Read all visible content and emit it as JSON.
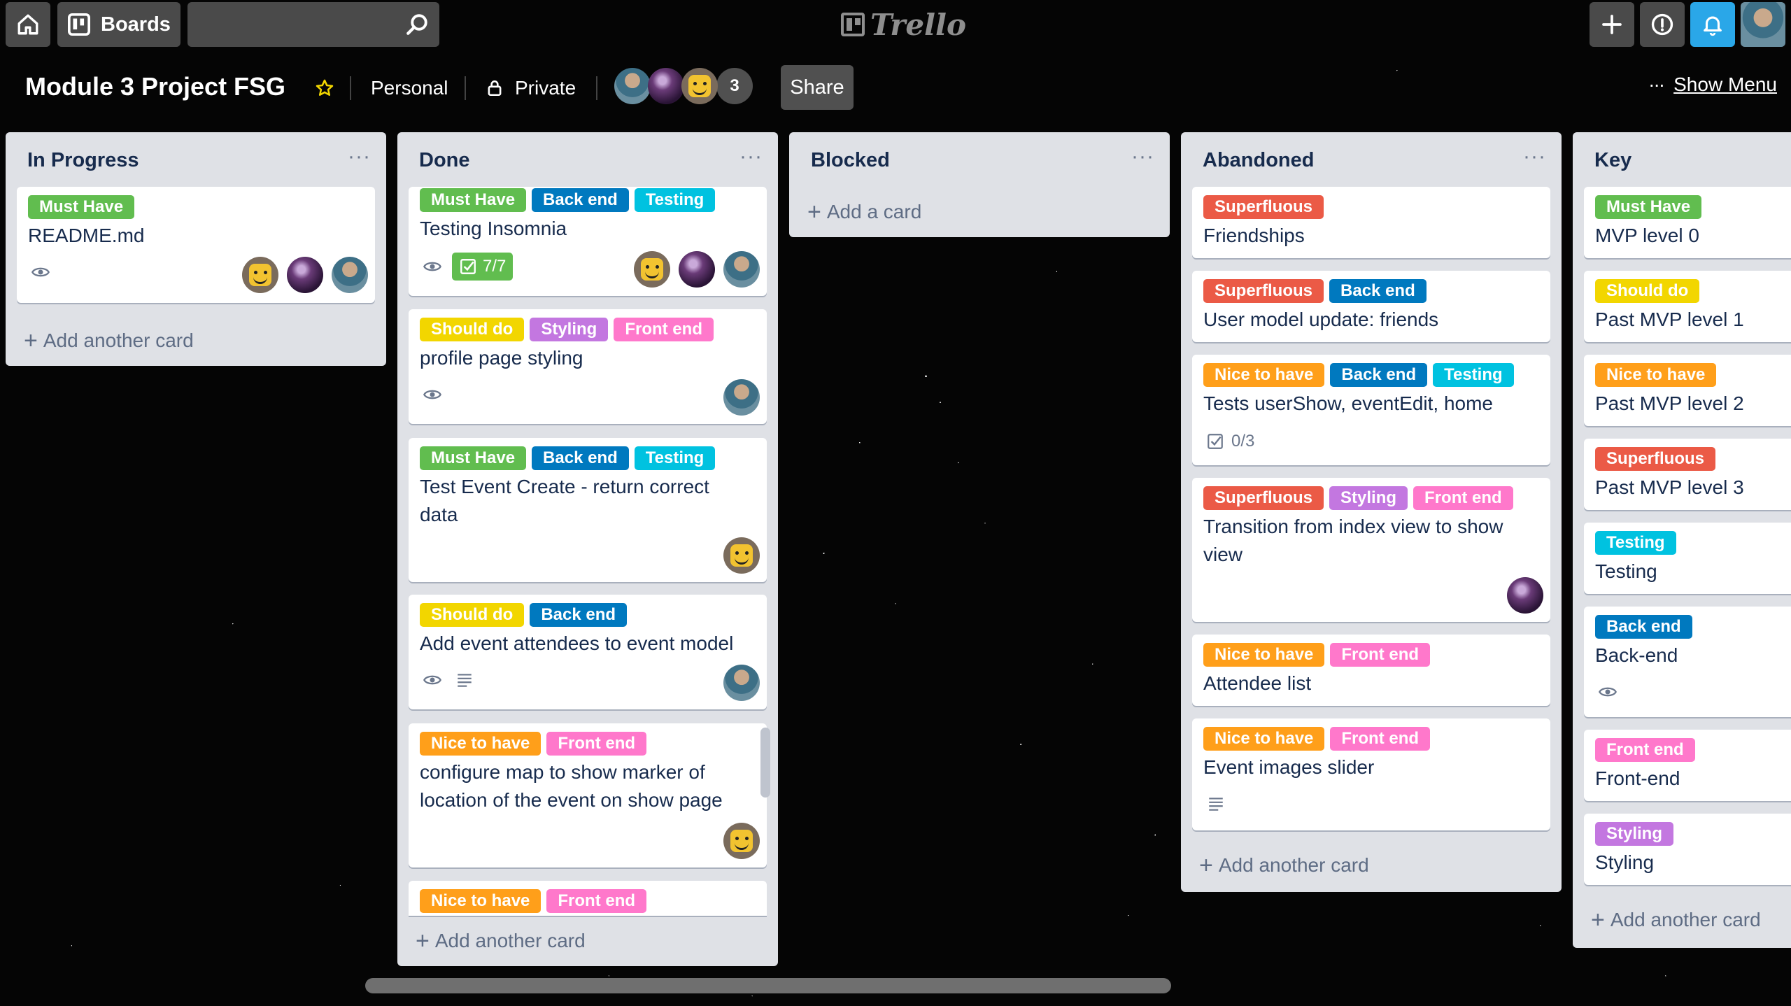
{
  "header": {
    "boards_label": "Boards",
    "search_placeholder": "",
    "logo_text": "Trello"
  },
  "board": {
    "title": "Module 3 Project FSG",
    "team": "Personal",
    "visibility": "Private",
    "member_count": "3",
    "share_label": "Share",
    "show_menu_label": "Show Menu"
  },
  "colors": {
    "green": "#61bd4f",
    "yellow": "#f2d600",
    "orange": "#ff9f1a",
    "red": "#eb5a46",
    "purple": "#c377e0",
    "blue": "#0079bf",
    "sky": "#00c2e0",
    "pink": "#ff78cb"
  },
  "lists": {
    "in_progress": {
      "title": "In Progress",
      "add_label": "Add another card",
      "cards": [
        {
          "labels": [
            "Must Have"
          ],
          "title": "README.md"
        }
      ]
    },
    "done": {
      "title": "Done",
      "add_label": "Add another card",
      "cards": [
        {
          "labels": [
            "Must Have",
            "Back end",
            "Testing"
          ],
          "title": "Testing Insomnia",
          "checklist": "7/7"
        },
        {
          "labels": [
            "Should do",
            "Styling",
            "Front end"
          ],
          "title": "profile page styling"
        },
        {
          "labels": [
            "Must Have",
            "Back end",
            "Testing"
          ],
          "title_line1": "Test Event Create - return correct",
          "title_line2": "data"
        },
        {
          "labels": [
            "Should do",
            "Back end"
          ],
          "title": "Add event attendees to event model"
        },
        {
          "labels": [
            "Nice to have",
            "Front end"
          ],
          "title_line1": "configure map to show marker of",
          "title_line2": "location of the event on show page"
        },
        {
          "labels": [
            "Nice to have",
            "Front end"
          ]
        }
      ]
    },
    "blocked": {
      "title": "Blocked",
      "add_label": "Add a card"
    },
    "abandoned": {
      "title": "Abandoned",
      "add_label": "Add another card",
      "cards": [
        {
          "labels": [
            "Superfluous"
          ],
          "title": "Friendships"
        },
        {
          "labels": [
            "Superfluous",
            "Back end"
          ],
          "title": "User model update: friends"
        },
        {
          "labels": [
            "Nice to have",
            "Back end",
            "Testing"
          ],
          "title": "Tests userShow, eventEdit, home",
          "checklist": "0/3"
        },
        {
          "labels": [
            "Superfluous",
            "Styling",
            "Front end"
          ],
          "title_line1": "Transition from index view to show",
          "title_line2": "view"
        },
        {
          "labels": [
            "Nice to have",
            "Front end"
          ],
          "title": "Attendee list"
        },
        {
          "labels": [
            "Nice to have",
            "Front end"
          ],
          "title": "Event images slider"
        }
      ]
    },
    "key": {
      "title": "Key",
      "add_label": "Add another card",
      "cards": [
        {
          "labels": [
            "Must Have"
          ],
          "title": "MVP level 0"
        },
        {
          "labels": [
            "Should do"
          ],
          "title": "Past MVP level 1"
        },
        {
          "labels": [
            "Nice to have"
          ],
          "title": "Past MVP level 2"
        },
        {
          "labels": [
            "Superfluous"
          ],
          "title": "Past MVP level 3"
        },
        {
          "labels": [
            "Testing"
          ],
          "title": "Testing"
        },
        {
          "labels": [
            "Back end"
          ],
          "title": "Back-end"
        },
        {
          "labels": [
            "Front end"
          ],
          "title": "Front-end"
        },
        {
          "labels": [
            "Styling"
          ],
          "title": "Styling"
        }
      ]
    }
  }
}
